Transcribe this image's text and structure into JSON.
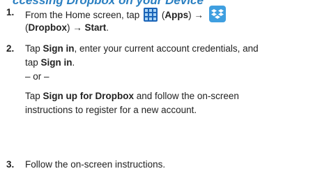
{
  "heading": "ccessing Dropbox on your Device",
  "steps": [
    {
      "number": "1.",
      "line1_pre": "From the Home screen, tap",
      "apps_label": "Apps",
      "arrow": "→",
      "line2_label": "Dropbox",
      "line2_arrow": "→",
      "line2_action": "Start",
      "open_paren": "(",
      "close_paren": ")",
      "period": "."
    },
    {
      "number": "2.",
      "l1_pre": "Tap ",
      "l1_bold": "Sign in",
      "l1_post": ", enter your current account credentials, and",
      "l2_pre": "tap ",
      "l2_bold": "Sign in",
      "l2_post": ".",
      "or": "– or –",
      "l3_pre": "Tap ",
      "l3_bold": "Sign up for Dropbox",
      "l3_post": " and follow the on-screen",
      "l4": "instructions to register for a new account."
    },
    {
      "number": "3.",
      "text": "Follow the on-screen instructions."
    }
  ],
  "icons": {
    "apps": "apps-grid-icon",
    "dropbox": "dropbox-icon"
  },
  "colors": {
    "heading": "#2a7fc1",
    "apps_icon": "#1a64b8",
    "dropbox_icon": "#3f9fe0"
  }
}
